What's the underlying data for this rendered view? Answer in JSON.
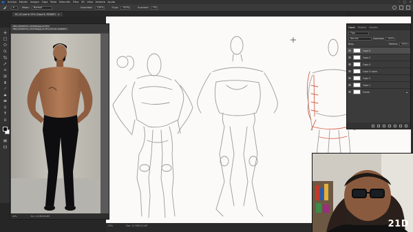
{
  "app": {
    "logo": "Ps"
  },
  "menu": [
    "Archivo",
    "Edición",
    "Imagen",
    "Capa",
    "Texto",
    "Selección",
    "Filtro",
    "3D",
    "Vista",
    "Ventana",
    "Ayuda"
  ],
  "options": {
    "mode_label": "Modo:",
    "mode_value": "Normal",
    "opacity_label": "Opacidad:",
    "opacity_value": "100%",
    "flow_label": "Flujo:",
    "flow_value": "100%",
    "smoothing_label": "Suavizar:",
    "smoothing_value": "0%"
  },
  "doc_tab": {
    "title": "RC_01.psd al 25% (Capa 6, RGB/8*)",
    "close": "×"
  },
  "photo_window": {
    "tabs": [
      "IMG_20200711_153040.jpg al 25%",
      "IMG_20200711_153748.jpg al 25% (Fondo, RGB/8*)"
    ],
    "status_zoom": "20%",
    "status_doc": "Doc: 23,8M/23,8M"
  },
  "status": {
    "zoom": "25%",
    "doc": "Doc: 21,3M/213,4M"
  },
  "layers_panel": {
    "tabs": [
      "Capas",
      "Historia",
      "Canales"
    ],
    "search_value": "Tipo",
    "blend_value": "Normal",
    "opacity_label": "Opacidad:",
    "opacity_value": "100%",
    "fill_label": "Relleno:",
    "fill_value": "100%",
    "lock_label": "Bloq.:",
    "layers": [
      {
        "name": "Capa 6",
        "selected": true
      },
      {
        "name": "Capa 5",
        "selected": false
      },
      {
        "name": "Capa 4",
        "selected": false
      },
      {
        "name": "Capa 3 copia",
        "selected": false
      },
      {
        "name": "Capa 3",
        "selected": false
      },
      {
        "name": "Capa 1",
        "selected": false
      },
      {
        "name": "Fondo",
        "selected": false
      }
    ]
  },
  "webcam": {
    "logo": "21D"
  },
  "colors": {
    "accent": "#2b7fd8",
    "sketch_red": "#d9604a",
    "panel": "#3b3b3b"
  }
}
